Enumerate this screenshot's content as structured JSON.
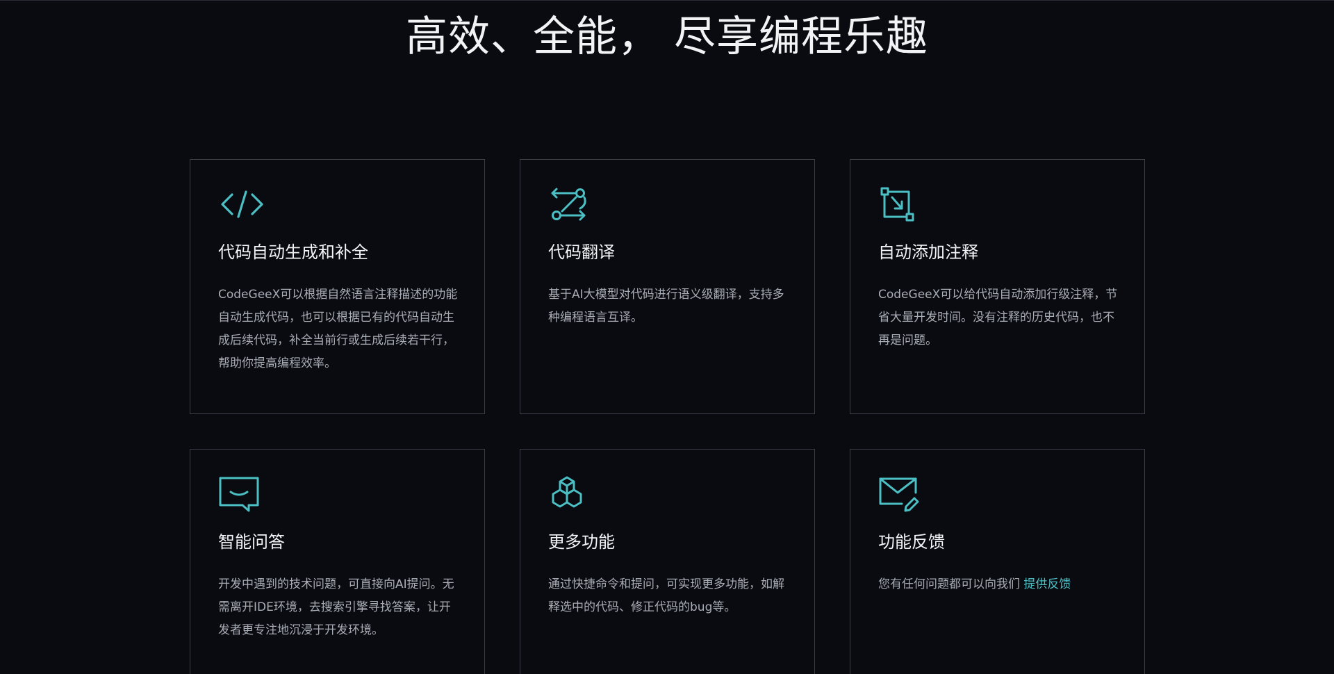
{
  "headline": "高效、全能， 尽享编程乐趣",
  "accent_color": "#4bbfc4",
  "cards": [
    {
      "icon": "code-icon",
      "title": "代码自动生成和补全",
      "description": "CodeGeeX可以根据自然语言注释描述的功能自动生成代码，也可以根据已有的代码自动生成后续代码，补全当前行或生成后续若干行，帮助你提高编程效率。"
    },
    {
      "icon": "translate-icon",
      "title": "代码翻译",
      "description": "基于AI大模型对代码进行语义级翻译，支持多种编程语言互译。"
    },
    {
      "icon": "comment-icon",
      "title": "自动添加注释",
      "description": "CodeGeeX可以给代码自动添加行级注释，节省大量开发时间。没有注释的历史代码，也不再是问题。"
    },
    {
      "icon": "chat-icon",
      "title": "智能问答",
      "description": "开发中遇到的技术问题，可直接向AI提问。无需离开IDE环境，去搜索引擎寻找答案，让开发者更专注地沉浸于开发环境。"
    },
    {
      "icon": "cubes-icon",
      "title": "更多功能",
      "description": "通过快捷命令和提问，可实现更多功能，如解释选中的代码、修正代码的bug等。"
    },
    {
      "icon": "mail-edit-icon",
      "title": "功能反馈",
      "description": "您有任何问题都可以向我们 ",
      "link_text": "提供反馈"
    }
  ]
}
